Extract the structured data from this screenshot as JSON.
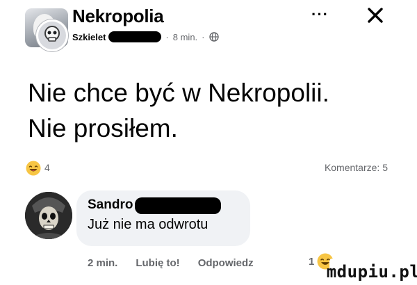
{
  "post": {
    "group_name": "Nekropolia",
    "author": "Szkielet",
    "time": "8 min.",
    "separator": "·",
    "more_label": "···",
    "text": "Nie chce być w Nekropolii.\nNie prosiłem."
  },
  "reactions": {
    "icon": "laughing-emoji-icon",
    "count": "4",
    "comments_label": "Komentarze: 5"
  },
  "comment": {
    "author": "Sandro",
    "text": "Już nie ma odwrotu",
    "time": "2 min.",
    "like_label": "Lubię to!",
    "reply_label": "Odpowiedz",
    "reaction_count": "1",
    "reaction_icon": "laughing-emoji-icon"
  },
  "watermark": "mdupiu.pl",
  "colors": {
    "text": "#050505",
    "secondary": "#65676b",
    "bubble": "#f0f2f5",
    "redaction": "#000000",
    "emoji": "#f7c544"
  }
}
